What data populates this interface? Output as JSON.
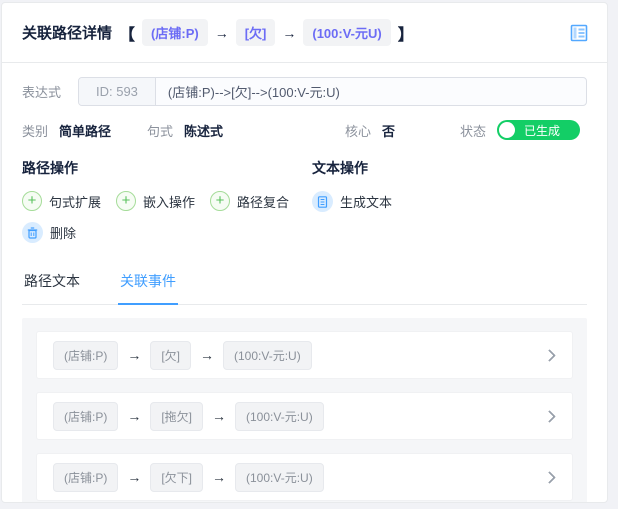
{
  "header": {
    "title": "关联路径详情",
    "bracket_open": "【",
    "bracket_close": "】",
    "arrow": "→",
    "path_tags": [
      "(店铺:P)",
      "[欠]",
      "(100:V-元U)"
    ]
  },
  "expression": {
    "label": "表达式",
    "id_prefix": "ID: 593",
    "value": "(店铺:P)-->[欠]-->(100:V-元:U)"
  },
  "meta": {
    "category_label": "类别",
    "category_value": "简单路径",
    "sentence_label": "句式",
    "sentence_value": "陈述式",
    "core_label": "核心",
    "core_value": "否",
    "status_label": "状态",
    "status_value": "已生成"
  },
  "path_ops": {
    "title": "路径操作",
    "buttons": [
      "句式扩展",
      "嵌入操作",
      "路径复合"
    ],
    "delete_label": "删除",
    "plus_glyph": "+"
  },
  "text_ops": {
    "title": "文本操作",
    "generate_label": "生成文本"
  },
  "tabs": [
    {
      "label": "路径文本",
      "active": false
    },
    {
      "label": "关联事件",
      "active": true
    }
  ],
  "events": {
    "arrow": "→",
    "rows": [
      {
        "nodes": [
          "(店铺:P)",
          "[欠]",
          "(100:V-元:U)"
        ]
      },
      {
        "nodes": [
          "(店铺:P)",
          "[拖欠]",
          "(100:V-元:U)"
        ]
      },
      {
        "nodes": [
          "(店铺:P)",
          "[欠下]",
          "(100:V-元:U)"
        ]
      }
    ]
  },
  "colors": {
    "accent_blue": "#409eff",
    "success_green": "#13ce66",
    "tag_purple": "#6c6cf5"
  },
  "icons": {
    "header": "notebook-icon",
    "add": "plus-icon",
    "delete": "trash-icon",
    "generate": "document-icon",
    "row": "chevron-right-icon"
  }
}
